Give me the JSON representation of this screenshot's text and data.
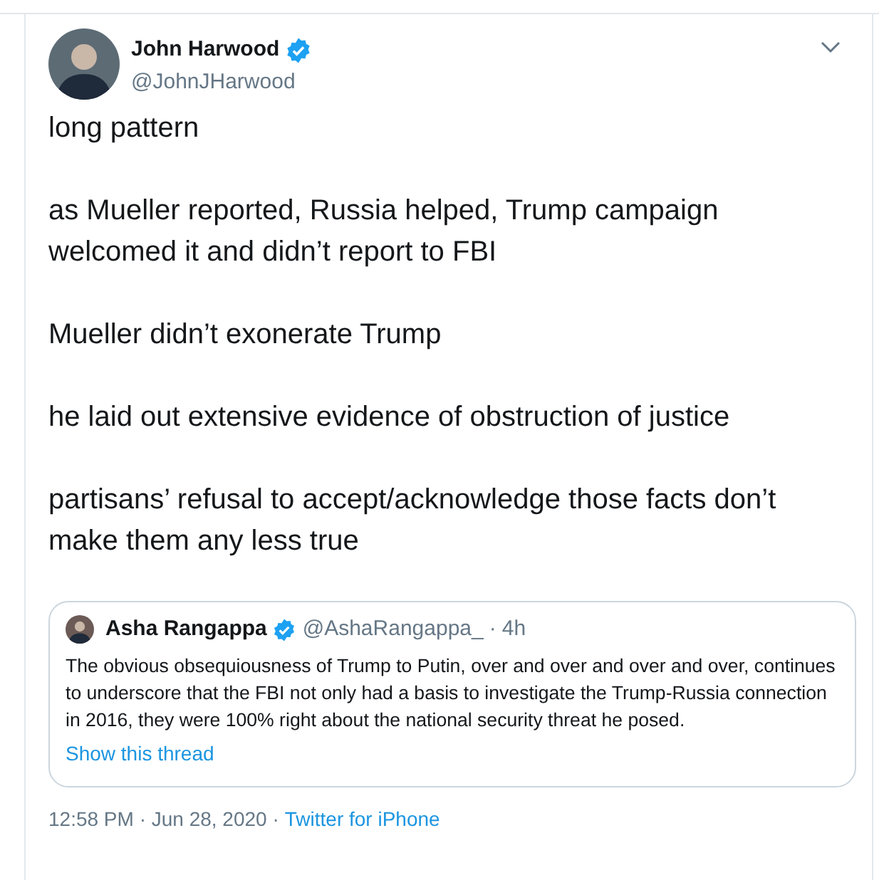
{
  "author": {
    "name": "John Harwood",
    "verified": true,
    "handle": "@JohnJHarwood"
  },
  "paragraphs": [
    "long pattern",
    "as Mueller reported, Russia helped, Trump campaign welcomed it and didn’t report to FBI",
    "Mueller didn’t exonerate Trump",
    "he laid out extensive evidence of obstruction of justice",
    "partisans’ refusal to accept/acknowledge those facts don’t make them any less true"
  ],
  "quoted_tweet": {
    "name": "Asha Rangappa",
    "verified": true,
    "handle": "@AshaRangappa_",
    "separator": "·",
    "time": "4h",
    "text": "The obvious obsequiousness of Trump to Putin, over and over and over and over, continues to underscore that the FBI not only had a basis to investigate the Trump-Russia connection in 2016, they were 100% right about the national security threat he posed.",
    "thread_link": "Show this thread"
  },
  "footer": {
    "time": "12:58 PM · Jun 28, 2020 ·",
    "source": "Twitter for iPhone"
  }
}
